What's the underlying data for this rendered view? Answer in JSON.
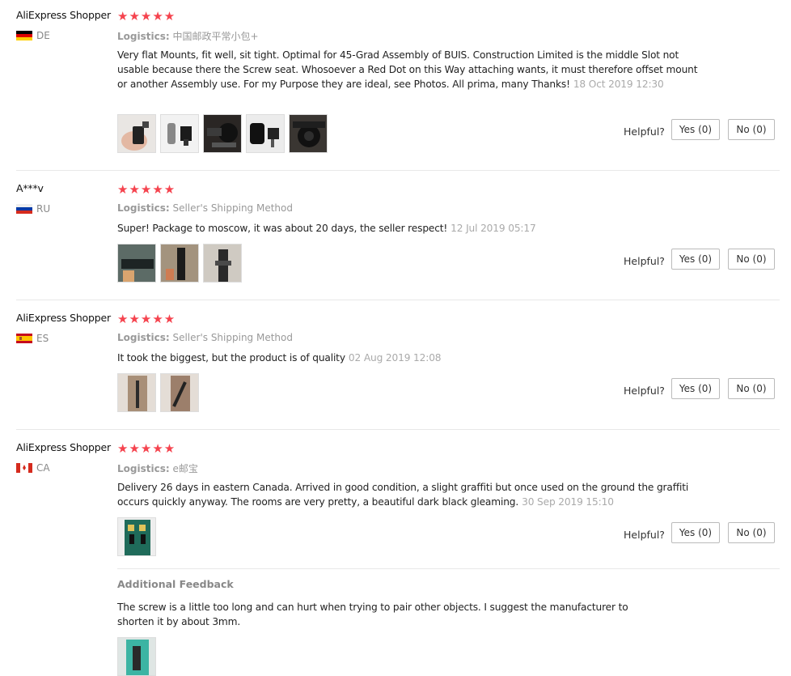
{
  "reviews": [
    {
      "name": "AliExpress Shopper",
      "country": "DE",
      "stars": "★★★★★",
      "logistics_label": "Logistics:",
      "logistics_value": "中国邮政平常小包+",
      "text": "Very flat Mounts, fit well, sit tight. Optimal for 45-Grad Assembly of BUIS. Construction Limited is the middle Slot not usable because there the Screw seat. Whosoever a Red Dot on this Way attaching wants, it must therefore offset mount or another Assembly use. For my Purpose they are ideal, see Photos. All prima, many Thanks!",
      "date": "18 Oct 2019 12:30",
      "helpful": "Helpful?",
      "yes": "Yes (0)",
      "no": "No (0)"
    },
    {
      "name": "A***v",
      "country": "RU",
      "stars": "★★★★★",
      "logistics_label": "Logistics:",
      "logistics_value": "Seller's Shipping Method",
      "text": "Super! Package to moscow, it was about 20 days, the seller respect!",
      "date": "12 Jul 2019 05:17",
      "helpful": "Helpful?",
      "yes": "Yes (0)",
      "no": "No (0)"
    },
    {
      "name": "AliExpress Shopper",
      "country": "ES",
      "stars": "★★★★★",
      "logistics_label": "Logistics:",
      "logistics_value": "Seller's Shipping Method",
      "text": "It took the biggest, but the product is of quality",
      "date": "02 Aug 2019 12:08",
      "helpful": "Helpful?",
      "yes": "Yes (0)",
      "no": "No (0)"
    },
    {
      "name": "AliExpress Shopper",
      "country": "CA",
      "stars": "★★★★★",
      "logistics_label": "Logistics:",
      "logistics_value": "e邮宝",
      "text": "Delivery 26 days in eastern Canada. Arrived in good condition, a slight graffiti but once used on the ground the graffiti occurs quickly anyway. The rooms are very pretty, a beautiful dark black gleaming.",
      "date": "30 Sep 2019 15:10",
      "helpful": "Helpful?",
      "yes": "Yes (0)",
      "no": "No (0)",
      "additional_title": "Additional Feedback",
      "additional_text": "The screw is a little too long and can hurt when trying to pair other objects. I suggest the manufacturer to shorten it by about 3mm."
    }
  ],
  "colors": {
    "star": "#f5434e",
    "muted": "#999999",
    "border": "#e8e8e8"
  }
}
